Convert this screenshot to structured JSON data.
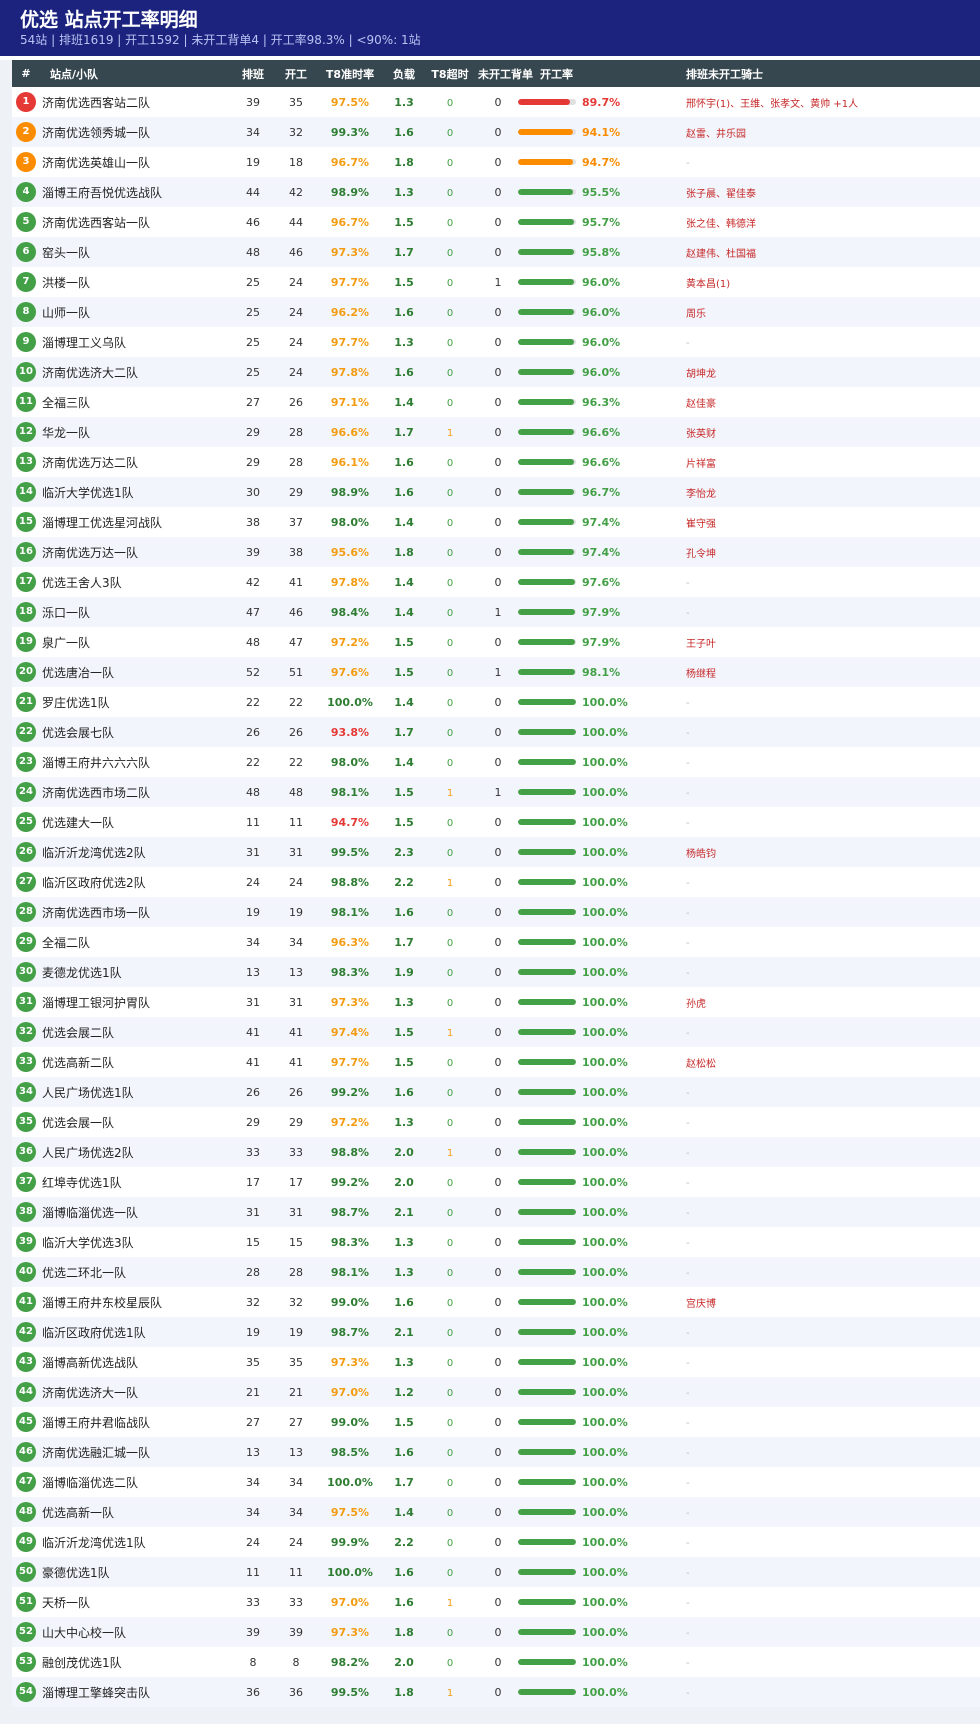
{
  "header": {
    "title": "优选 站点开工率明细",
    "subtitle": "54站 | 排班1619 | 开工1592 | 未开工背单4 | 开工率98.3% | <90%: 1站"
  },
  "columns": {
    "rank": "#",
    "name": "站点/小队",
    "scheduled": "排班",
    "started": "开工",
    "t8": "T8准时率",
    "load": "负载",
    "t8_timeout": "T8超时",
    "unstarted": "未开工背单",
    "rate": "开工率",
    "riders": "排班未开工骑士"
  },
  "colors": {
    "red": "#e53935",
    "orange": "#fb8c00",
    "green": "#43a047",
    "t8_green": "#2e7d32",
    "t8_orange": "#f39c12",
    "t8_red": "#e53935"
  },
  "rows": [
    {
      "rank": "1",
      "name": "济南优选西客站二队",
      "scheduled": "39",
      "started": "35",
      "t8": "97.5%",
      "load": "1.3",
      "timeout": "0",
      "unstarted": "0",
      "rate": "89.7%",
      "rate_value": 89.7,
      "riders": "邢怀宇(1)、王维、张孝文、黄帅 +1人"
    },
    {
      "rank": "2",
      "name": "济南优选领秀城一队",
      "scheduled": "34",
      "started": "32",
      "t8": "99.3%",
      "load": "1.6",
      "timeout": "0",
      "unstarted": "0",
      "rate": "94.1%",
      "rate_value": 94.1,
      "riders": "赵雷、井乐园"
    },
    {
      "rank": "3",
      "name": "济南优选英雄山一队",
      "scheduled": "19",
      "started": "18",
      "t8": "96.7%",
      "load": "1.8",
      "timeout": "0",
      "unstarted": "0",
      "rate": "94.7%",
      "rate_value": 94.7,
      "riders": "-"
    },
    {
      "rank": "4",
      "name": "淄博王府吾悦优选战队",
      "scheduled": "44",
      "started": "42",
      "t8": "98.9%",
      "load": "1.3",
      "timeout": "0",
      "unstarted": "0",
      "rate": "95.5%",
      "rate_value": 95.5,
      "riders": "张子晨、翟佳泰"
    },
    {
      "rank": "5",
      "name": "济南优选西客站一队",
      "scheduled": "46",
      "started": "44",
      "t8": "96.7%",
      "load": "1.5",
      "timeout": "0",
      "unstarted": "0",
      "rate": "95.7%",
      "rate_value": 95.7,
      "riders": "张之佳、韩德洋"
    },
    {
      "rank": "6",
      "name": "窑头一队",
      "scheduled": "48",
      "started": "46",
      "t8": "97.3%",
      "load": "1.7",
      "timeout": "0",
      "unstarted": "0",
      "rate": "95.8%",
      "rate_value": 95.8,
      "riders": "赵建伟、杜国福"
    },
    {
      "rank": "7",
      "name": "洪楼一队",
      "scheduled": "25",
      "started": "24",
      "t8": "97.7%",
      "load": "1.5",
      "timeout": "0",
      "unstarted": "1",
      "rate": "96.0%",
      "rate_value": 96.0,
      "riders": "黄本昌(1)"
    },
    {
      "rank": "8",
      "name": "山师一队",
      "scheduled": "25",
      "started": "24",
      "t8": "96.2%",
      "load": "1.6",
      "timeout": "0",
      "unstarted": "0",
      "rate": "96.0%",
      "rate_value": 96.0,
      "riders": "周乐"
    },
    {
      "rank": "9",
      "name": "淄博理工义乌队",
      "scheduled": "25",
      "started": "24",
      "t8": "97.7%",
      "load": "1.3",
      "timeout": "0",
      "unstarted": "0",
      "rate": "96.0%",
      "rate_value": 96.0,
      "riders": "-"
    },
    {
      "rank": "10",
      "name": "济南优选济大二队",
      "scheduled": "25",
      "started": "24",
      "t8": "97.8%",
      "load": "1.6",
      "timeout": "0",
      "unstarted": "0",
      "rate": "96.0%",
      "rate_value": 96.0,
      "riders": "胡坤龙"
    },
    {
      "rank": "11",
      "name": "全福三队",
      "scheduled": "27",
      "started": "26",
      "t8": "97.1%",
      "load": "1.4",
      "timeout": "0",
      "unstarted": "0",
      "rate": "96.3%",
      "rate_value": 96.3,
      "riders": "赵佳豪"
    },
    {
      "rank": "12",
      "name": "华龙一队",
      "scheduled": "29",
      "started": "28",
      "t8": "96.6%",
      "load": "1.7",
      "timeout": "1",
      "unstarted": "0",
      "rate": "96.6%",
      "rate_value": 96.6,
      "riders": "张英财"
    },
    {
      "rank": "13",
      "name": "济南优选万达二队",
      "scheduled": "29",
      "started": "28",
      "t8": "96.1%",
      "load": "1.6",
      "timeout": "0",
      "unstarted": "0",
      "rate": "96.6%",
      "rate_value": 96.6,
      "riders": "片祥富"
    },
    {
      "rank": "14",
      "name": "临沂大学优选1队",
      "scheduled": "30",
      "started": "29",
      "t8": "98.9%",
      "load": "1.6",
      "timeout": "0",
      "unstarted": "0",
      "rate": "96.7%",
      "rate_value": 96.7,
      "riders": "李怡龙"
    },
    {
      "rank": "15",
      "name": "淄博理工优选星河战队",
      "scheduled": "38",
      "started": "37",
      "t8": "98.0%",
      "load": "1.4",
      "timeout": "0",
      "unstarted": "0",
      "rate": "97.4%",
      "rate_value": 97.4,
      "riders": "崔守强"
    },
    {
      "rank": "16",
      "name": "济南优选万达一队",
      "scheduled": "39",
      "started": "38",
      "t8": "95.6%",
      "load": "1.8",
      "timeout": "0",
      "unstarted": "0",
      "rate": "97.4%",
      "rate_value": 97.4,
      "riders": "孔令坤"
    },
    {
      "rank": "17",
      "name": "优选王舍人3队",
      "scheduled": "42",
      "started": "41",
      "t8": "97.8%",
      "load": "1.4",
      "timeout": "0",
      "unstarted": "0",
      "rate": "97.6%",
      "rate_value": 97.6,
      "riders": "-"
    },
    {
      "rank": "18",
      "name": "泺口一队",
      "scheduled": "47",
      "started": "46",
      "t8": "98.4%",
      "load": "1.4",
      "timeout": "0",
      "unstarted": "1",
      "rate": "97.9%",
      "rate_value": 97.9,
      "riders": "-"
    },
    {
      "rank": "19",
      "name": "泉广一队",
      "scheduled": "48",
      "started": "47",
      "t8": "97.2%",
      "load": "1.5",
      "timeout": "0",
      "unstarted": "0",
      "rate": "97.9%",
      "rate_value": 97.9,
      "riders": "王子叶"
    },
    {
      "rank": "20",
      "name": "优选唐冶一队",
      "scheduled": "52",
      "started": "51",
      "t8": "97.6%",
      "load": "1.5",
      "timeout": "0",
      "unstarted": "1",
      "rate": "98.1%",
      "rate_value": 98.1,
      "riders": "杨继程"
    },
    {
      "rank": "21",
      "name": "罗庄优选1队",
      "scheduled": "22",
      "started": "22",
      "t8": "100.0%",
      "load": "1.4",
      "timeout": "0",
      "unstarted": "0",
      "rate": "100.0%",
      "rate_value": 100.0,
      "riders": "-"
    },
    {
      "rank": "22",
      "name": "优选会展七队",
      "scheduled": "26",
      "started": "26",
      "t8": "93.8%",
      "load": "1.7",
      "timeout": "0",
      "unstarted": "0",
      "rate": "100.0%",
      "rate_value": 100.0,
      "riders": "-"
    },
    {
      "rank": "23",
      "name": "淄博王府井六六六队",
      "scheduled": "22",
      "started": "22",
      "t8": "98.0%",
      "load": "1.4",
      "timeout": "0",
      "unstarted": "0",
      "rate": "100.0%",
      "rate_value": 100.0,
      "riders": "-"
    },
    {
      "rank": "24",
      "name": "济南优选西市场二队",
      "scheduled": "48",
      "started": "48",
      "t8": "98.1%",
      "load": "1.5",
      "timeout": "1",
      "unstarted": "1",
      "rate": "100.0%",
      "rate_value": 100.0,
      "riders": "-"
    },
    {
      "rank": "25",
      "name": "优选建大一队",
      "scheduled": "11",
      "started": "11",
      "t8": "94.7%",
      "load": "1.5",
      "timeout": "0",
      "unstarted": "0",
      "rate": "100.0%",
      "rate_value": 100.0,
      "riders": "-"
    },
    {
      "rank": "26",
      "name": "临沂沂龙湾优选2队",
      "scheduled": "31",
      "started": "31",
      "t8": "99.5%",
      "load": "2.3",
      "timeout": "0",
      "unstarted": "0",
      "rate": "100.0%",
      "rate_value": 100.0,
      "riders": "杨皓钧"
    },
    {
      "rank": "27",
      "name": "临沂区政府优选2队",
      "scheduled": "24",
      "started": "24",
      "t8": "98.8%",
      "load": "2.2",
      "timeout": "1",
      "unstarted": "0",
      "rate": "100.0%",
      "rate_value": 100.0,
      "riders": "-"
    },
    {
      "rank": "28",
      "name": "济南优选西市场一队",
      "scheduled": "19",
      "started": "19",
      "t8": "98.1%",
      "load": "1.6",
      "timeout": "0",
      "unstarted": "0",
      "rate": "100.0%",
      "rate_value": 100.0,
      "riders": "-"
    },
    {
      "rank": "29",
      "name": "全福二队",
      "scheduled": "34",
      "started": "34",
      "t8": "96.3%",
      "load": "1.7",
      "timeout": "0",
      "unstarted": "0",
      "rate": "100.0%",
      "rate_value": 100.0,
      "riders": "-"
    },
    {
      "rank": "30",
      "name": "麦德龙优选1队",
      "scheduled": "13",
      "started": "13",
      "t8": "98.3%",
      "load": "1.9",
      "timeout": "0",
      "unstarted": "0",
      "rate": "100.0%",
      "rate_value": 100.0,
      "riders": "-"
    },
    {
      "rank": "31",
      "name": "淄博理工银河护胃队",
      "scheduled": "31",
      "started": "31",
      "t8": "97.3%",
      "load": "1.3",
      "timeout": "0",
      "unstarted": "0",
      "rate": "100.0%",
      "rate_value": 100.0,
      "riders": "孙虎"
    },
    {
      "rank": "32",
      "name": "优选会展二队",
      "scheduled": "41",
      "started": "41",
      "t8": "97.4%",
      "load": "1.5",
      "timeout": "1",
      "unstarted": "0",
      "rate": "100.0%",
      "rate_value": 100.0,
      "riders": "-"
    },
    {
      "rank": "33",
      "name": "优选高新二队",
      "scheduled": "41",
      "started": "41",
      "t8": "97.7%",
      "load": "1.5",
      "timeout": "0",
      "unstarted": "0",
      "rate": "100.0%",
      "rate_value": 100.0,
      "riders": "赵松松"
    },
    {
      "rank": "34",
      "name": "人民广场优选1队",
      "scheduled": "26",
      "started": "26",
      "t8": "99.2%",
      "load": "1.6",
      "timeout": "0",
      "unstarted": "0",
      "rate": "100.0%",
      "rate_value": 100.0,
      "riders": "-"
    },
    {
      "rank": "35",
      "name": "优选会展一队",
      "scheduled": "29",
      "started": "29",
      "t8": "97.2%",
      "load": "1.3",
      "timeout": "0",
      "unstarted": "0",
      "rate": "100.0%",
      "rate_value": 100.0,
      "riders": "-"
    },
    {
      "rank": "36",
      "name": "人民广场优选2队",
      "scheduled": "33",
      "started": "33",
      "t8": "98.8%",
      "load": "2.0",
      "timeout": "1",
      "unstarted": "0",
      "rate": "100.0%",
      "rate_value": 100.0,
      "riders": "-"
    },
    {
      "rank": "37",
      "name": "红埠寺优选1队",
      "scheduled": "17",
      "started": "17",
      "t8": "99.2%",
      "load": "2.0",
      "timeout": "0",
      "unstarted": "0",
      "rate": "100.0%",
      "rate_value": 100.0,
      "riders": "-"
    },
    {
      "rank": "38",
      "name": "淄博临淄优选一队",
      "scheduled": "31",
      "started": "31",
      "t8": "98.7%",
      "load": "2.1",
      "timeout": "0",
      "unstarted": "0",
      "rate": "100.0%",
      "rate_value": 100.0,
      "riders": "-"
    },
    {
      "rank": "39",
      "name": "临沂大学优选3队",
      "scheduled": "15",
      "started": "15",
      "t8": "98.3%",
      "load": "1.3",
      "timeout": "0",
      "unstarted": "0",
      "rate": "100.0%",
      "rate_value": 100.0,
      "riders": "-"
    },
    {
      "rank": "40",
      "name": "优选二环北一队",
      "scheduled": "28",
      "started": "28",
      "t8": "98.1%",
      "load": "1.3",
      "timeout": "0",
      "unstarted": "0",
      "rate": "100.0%",
      "rate_value": 100.0,
      "riders": "-"
    },
    {
      "rank": "41",
      "name": "淄博王府井东校星辰队",
      "scheduled": "32",
      "started": "32",
      "t8": "99.0%",
      "load": "1.6",
      "timeout": "0",
      "unstarted": "0",
      "rate": "100.0%",
      "rate_value": 100.0,
      "riders": "宫庆博"
    },
    {
      "rank": "42",
      "name": "临沂区政府优选1队",
      "scheduled": "19",
      "started": "19",
      "t8": "98.7%",
      "load": "2.1",
      "timeout": "0",
      "unstarted": "0",
      "rate": "100.0%",
      "rate_value": 100.0,
      "riders": "-"
    },
    {
      "rank": "43",
      "name": "淄博高新优选战队",
      "scheduled": "35",
      "started": "35",
      "t8": "97.3%",
      "load": "1.3",
      "timeout": "0",
      "unstarted": "0",
      "rate": "100.0%",
      "rate_value": 100.0,
      "riders": "-"
    },
    {
      "rank": "44",
      "name": "济南优选济大一队",
      "scheduled": "21",
      "started": "21",
      "t8": "97.0%",
      "load": "1.2",
      "timeout": "0",
      "unstarted": "0",
      "rate": "100.0%",
      "rate_value": 100.0,
      "riders": "-"
    },
    {
      "rank": "45",
      "name": "淄博王府井君临战队",
      "scheduled": "27",
      "started": "27",
      "t8": "99.0%",
      "load": "1.5",
      "timeout": "0",
      "unstarted": "0",
      "rate": "100.0%",
      "rate_value": 100.0,
      "riders": "-"
    },
    {
      "rank": "46",
      "name": "济南优选融汇城一队",
      "scheduled": "13",
      "started": "13",
      "t8": "98.5%",
      "load": "1.6",
      "timeout": "0",
      "unstarted": "0",
      "rate": "100.0%",
      "rate_value": 100.0,
      "riders": "-"
    },
    {
      "rank": "47",
      "name": "淄博临淄优选二队",
      "scheduled": "34",
      "started": "34",
      "t8": "100.0%",
      "load": "1.7",
      "timeout": "0",
      "unstarted": "0",
      "rate": "100.0%",
      "rate_value": 100.0,
      "riders": "-"
    },
    {
      "rank": "48",
      "name": "优选高新一队",
      "scheduled": "34",
      "started": "34",
      "t8": "97.5%",
      "load": "1.4",
      "timeout": "0",
      "unstarted": "0",
      "rate": "100.0%",
      "rate_value": 100.0,
      "riders": "-"
    },
    {
      "rank": "49",
      "name": "临沂沂龙湾优选1队",
      "scheduled": "24",
      "started": "24",
      "t8": "99.9%",
      "load": "2.2",
      "timeout": "0",
      "unstarted": "0",
      "rate": "100.0%",
      "rate_value": 100.0,
      "riders": "-"
    },
    {
      "rank": "50",
      "name": "豪德优选1队",
      "scheduled": "11",
      "started": "11",
      "t8": "100.0%",
      "load": "1.6",
      "timeout": "0",
      "unstarted": "0",
      "rate": "100.0%",
      "rate_value": 100.0,
      "riders": "-"
    },
    {
      "rank": "51",
      "name": "天桥一队",
      "scheduled": "33",
      "started": "33",
      "t8": "97.0%",
      "load": "1.6",
      "timeout": "1",
      "unstarted": "0",
      "rate": "100.0%",
      "rate_value": 100.0,
      "riders": "-"
    },
    {
      "rank": "52",
      "name": "山大中心校一队",
      "scheduled": "39",
      "started": "39",
      "t8": "97.3%",
      "load": "1.8",
      "timeout": "0",
      "unstarted": "0",
      "rate": "100.0%",
      "rate_value": 100.0,
      "riders": "-"
    },
    {
      "rank": "53",
      "name": "融创茂优选1队",
      "scheduled": "8",
      "started": "8",
      "t8": "98.2%",
      "load": "2.0",
      "timeout": "0",
      "unstarted": "0",
      "rate": "100.0%",
      "rate_value": 100.0,
      "riders": "-"
    },
    {
      "rank": "54",
      "name": "淄博理工擎蜂突击队",
      "scheduled": "36",
      "started": "36",
      "t8": "99.5%",
      "load": "1.8",
      "timeout": "1",
      "unstarted": "0",
      "rate": "100.0%",
      "rate_value": 100.0,
      "riders": "-"
    }
  ]
}
